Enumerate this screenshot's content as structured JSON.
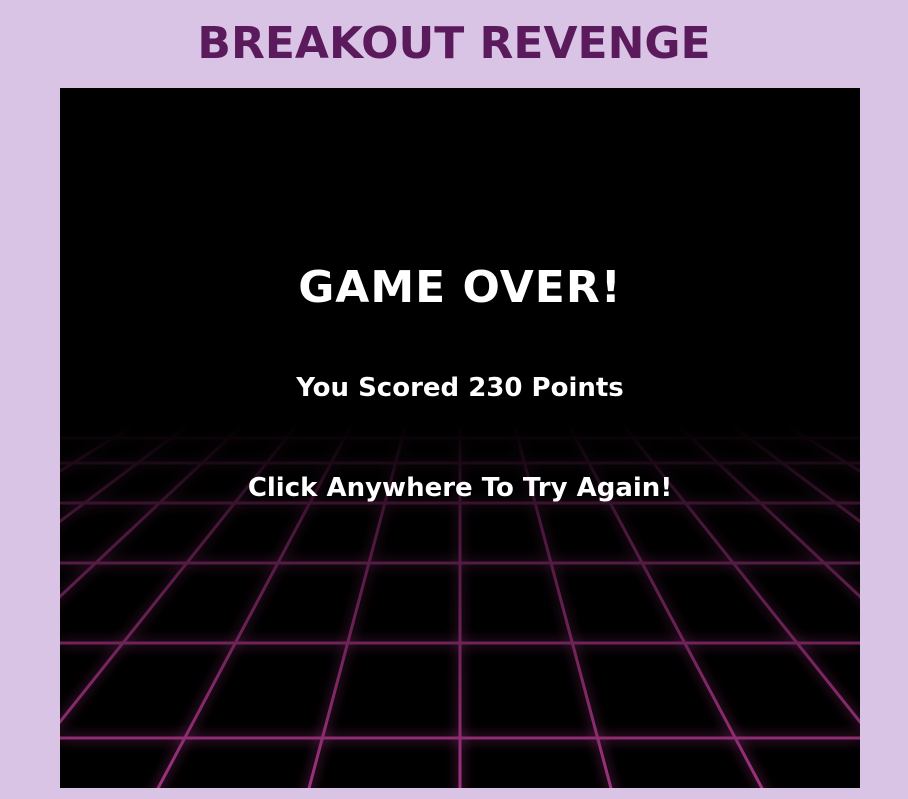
{
  "header": {
    "title": "BREAKOUT REVENGE"
  },
  "game": {
    "game_over_title": "GAME OVER!",
    "score_message": "You Scored 230 Points",
    "retry_message": "Click Anywhere To Try Again!",
    "score": 230
  },
  "colors": {
    "page_background": "#d9c4e6",
    "title": "#5a1a5c",
    "canvas_background": "#000000",
    "grid_line": "#b0388c",
    "text": "#ffffff"
  }
}
